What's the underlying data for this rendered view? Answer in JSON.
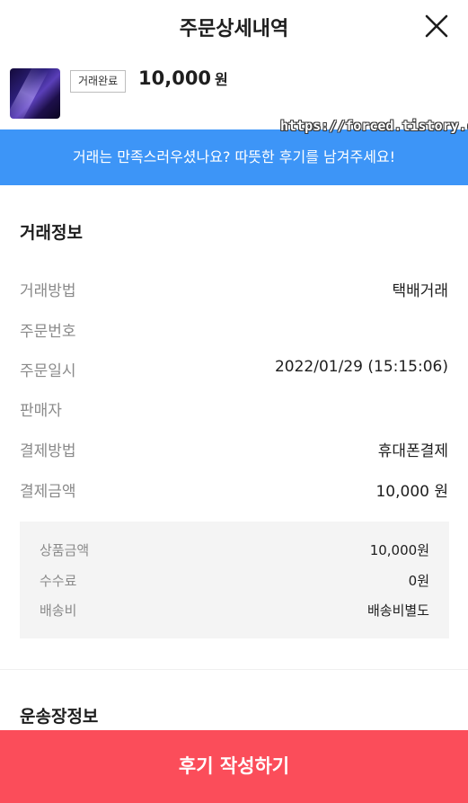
{
  "header": {
    "title": "주문상세내역"
  },
  "product": {
    "status_badge": "거래완료",
    "price": "10,000",
    "price_unit": "원"
  },
  "watermark": "https://forced.tistory.com",
  "review_banner": {
    "text": "거래는 만족스러우셨나요? 따뜻한 후기를 남겨주세요!"
  },
  "transaction": {
    "section_title": "거래정보",
    "rows": [
      {
        "label": "거래방법",
        "value": "택배거래"
      },
      {
        "label": "주문번호",
        "value": ""
      },
      {
        "label": "주문일시",
        "value": "2022/01/29 (15:15:06)"
      },
      {
        "label": "판매자",
        "value": ""
      },
      {
        "label": "결제방법",
        "value": "휴대폰결제"
      },
      {
        "label": "결제금액",
        "value": "10,000 원"
      }
    ],
    "breakdown": [
      {
        "label": "상품금액",
        "value": "10,000원"
      },
      {
        "label": "수수료",
        "value": "0원"
      },
      {
        "label": "배송비",
        "value": "배송비별도"
      }
    ]
  },
  "shipping": {
    "section_title": "운송장정보"
  },
  "cta": {
    "label": "후기 작성하기"
  },
  "colors": {
    "banner": "#3d95f7",
    "cta": "#fb4d5a",
    "breakdown_bg": "#f4f4f4"
  }
}
